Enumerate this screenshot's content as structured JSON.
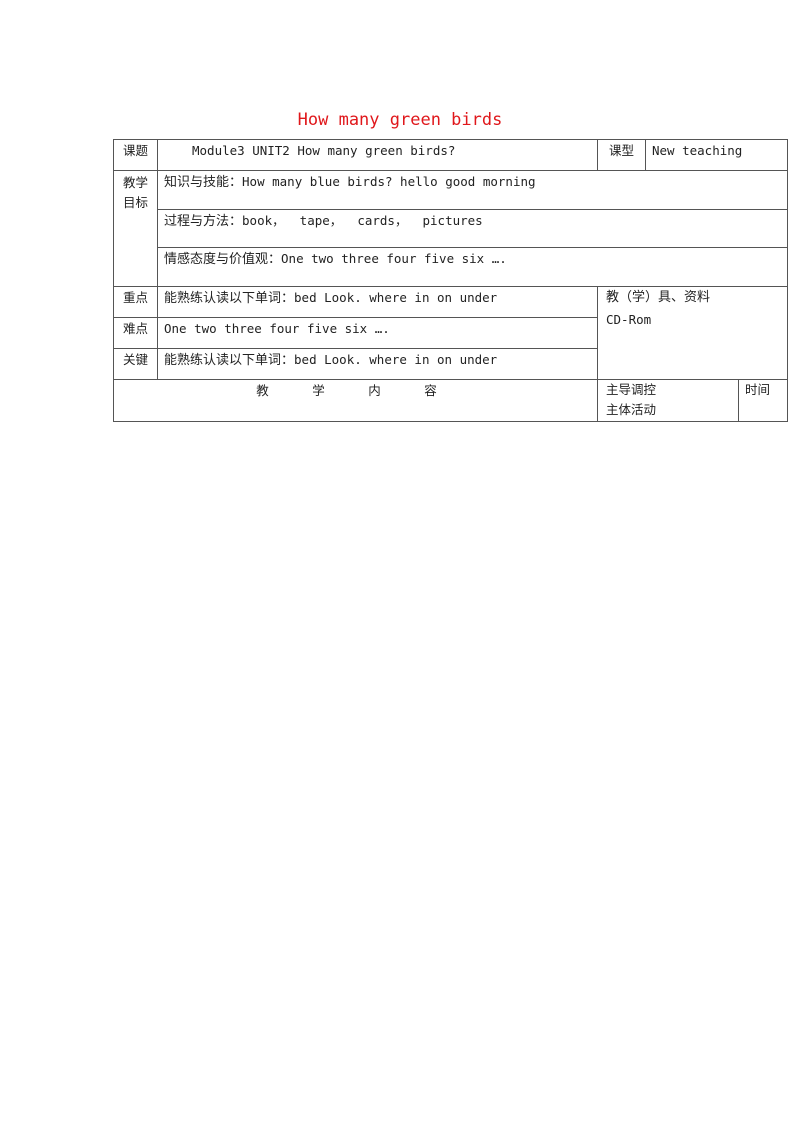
{
  "title": "How many green birds",
  "table": {
    "topic_label": "课题",
    "topic_value": "Module3 UNIT2 How many green birds?",
    "type_label": "课型",
    "type_value": "New teaching",
    "goals_label": "教学目标",
    "goals": [
      {
        "label": "知识与技能：",
        "text": "How many blue birds? hello good morning"
      },
      {
        "label": "过程与方法：",
        "text": "book，  tape，  cards，  pictures"
      },
      {
        "label": "情感态度与价值观：",
        "text": "One two three four five six …."
      }
    ],
    "key_point_label": "重点",
    "key_point_cn": "能熟练认读以下单词：",
    "key_point_text": "bed Look. where in on under",
    "difficulty_label": "难点",
    "difficulty_text": "One two three four five six ….",
    "crux_label": "关键",
    "crux_cn": "能熟练认读以下单词：",
    "crux_text": "bed Look. where in on under",
    "materials_label": "教（学）具、资料",
    "materials_value": "CD-Rom",
    "content_label": "教 学 内 容",
    "guide_label_1": "主导调控",
    "guide_label_2": "主体活动",
    "time_label": "时间"
  }
}
